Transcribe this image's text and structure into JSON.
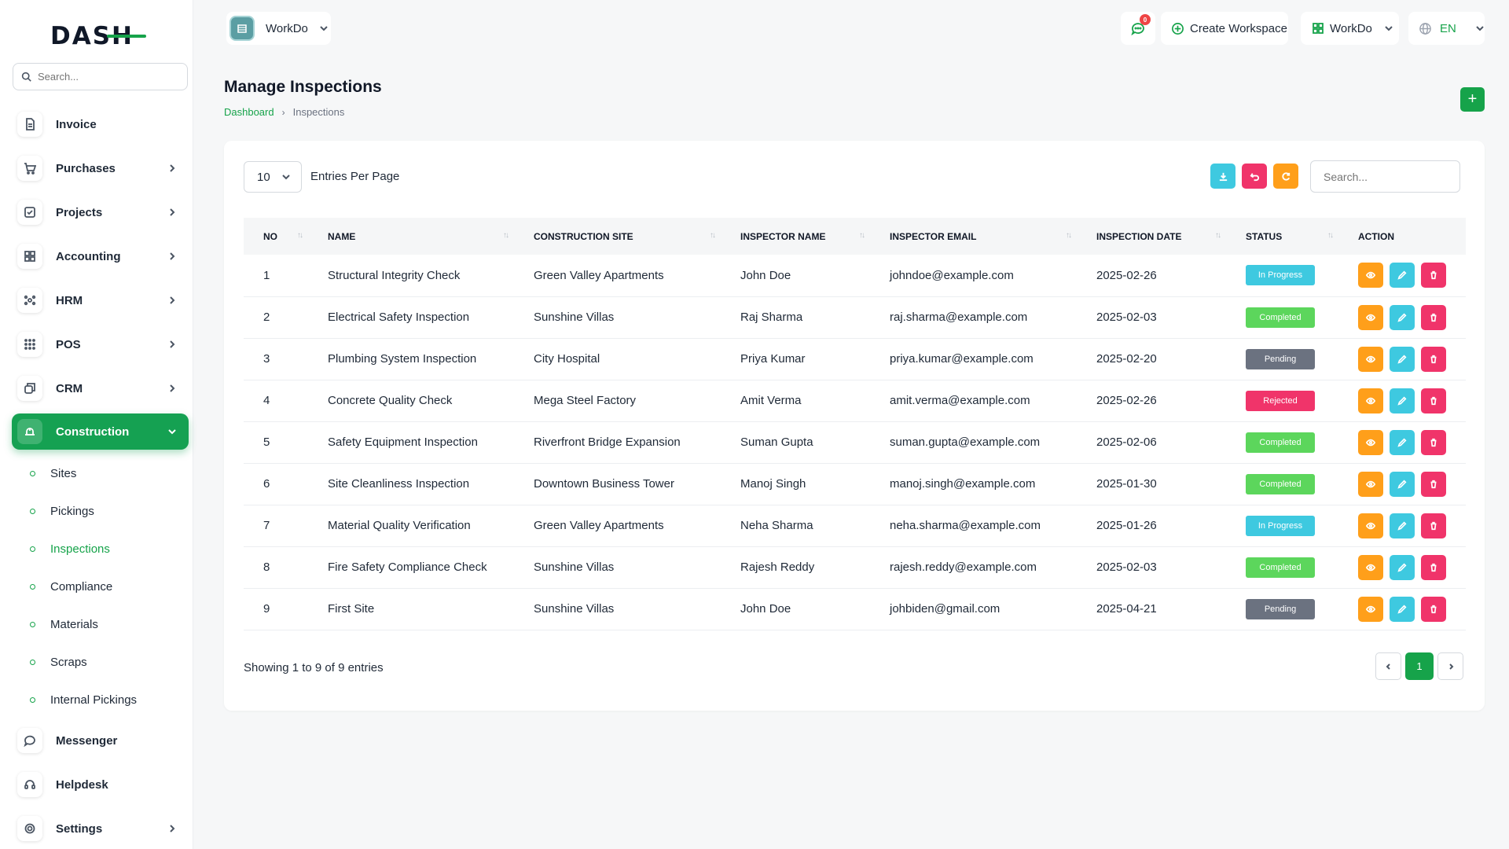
{
  "brand": {
    "logo_text": "DASH"
  },
  "sidebar": {
    "search_placeholder": "Search...",
    "items": [
      {
        "label": "Invoice",
        "icon": "file-icon",
        "has_children": false
      },
      {
        "label": "Purchases",
        "icon": "cart-icon",
        "has_children": true
      },
      {
        "label": "Projects",
        "icon": "checkbox-icon",
        "has_children": true
      },
      {
        "label": "Accounting",
        "icon": "grid-icon",
        "has_children": true
      },
      {
        "label": "HRM",
        "icon": "users-icon",
        "has_children": true
      },
      {
        "label": "POS",
        "icon": "dots-grid-icon",
        "has_children": true
      },
      {
        "label": "CRM",
        "icon": "layers-icon",
        "has_children": true
      },
      {
        "label": "Construction",
        "icon": "construction-icon",
        "has_children": true,
        "active": true
      },
      {
        "label": "Messenger",
        "icon": "chat-icon",
        "has_children": false
      },
      {
        "label": "Helpdesk",
        "icon": "headset-icon",
        "has_children": false
      },
      {
        "label": "Settings",
        "icon": "gear-icon",
        "has_children": true
      }
    ],
    "construction_sub": [
      "Sites",
      "Pickings",
      "Inspections",
      "Compliance",
      "Materials",
      "Scraps",
      "Internal Pickings"
    ],
    "active_sub": "Inspections"
  },
  "topbar": {
    "workspace_name": "WorkDo",
    "message_count": "0",
    "create_workspace": "Create Workspace",
    "workspace_switch": "WorkDo",
    "language": "EN"
  },
  "page": {
    "title": "Manage Inspections",
    "breadcrumb_home": "Dashboard",
    "breadcrumb_current": "Inspections",
    "add_label": "+"
  },
  "table_controls": {
    "per_page": "10",
    "per_page_label": "Entries Per Page",
    "search_placeholder": "Search..."
  },
  "table": {
    "columns": [
      "NO",
      "NAME",
      "CONSTRUCTION SITE",
      "INSPECTOR NAME",
      "INSPECTOR EMAIL",
      "INSPECTION DATE",
      "STATUS",
      "ACTION"
    ],
    "rows": [
      {
        "no": "1",
        "name": "Structural Integrity Check",
        "site": "Green Valley Apartments",
        "inspector": "John Doe",
        "email": "johndoe@example.com",
        "date": "2025-02-26",
        "status": "In Progress",
        "status_type": "progress"
      },
      {
        "no": "2",
        "name": "Electrical Safety Inspection",
        "site": "Sunshine Villas",
        "inspector": "Raj Sharma",
        "email": "raj.sharma@example.com",
        "date": "2025-02-03",
        "status": "Completed",
        "status_type": "completed"
      },
      {
        "no": "3",
        "name": "Plumbing System Inspection",
        "site": "City Hospital",
        "inspector": "Priya Kumar",
        "email": "priya.kumar@example.com",
        "date": "2025-02-20",
        "status": "Pending",
        "status_type": "pending"
      },
      {
        "no": "4",
        "name": "Concrete Quality Check",
        "site": "Mega Steel Factory",
        "inspector": "Amit Verma",
        "email": "amit.verma@example.com",
        "date": "2025-02-26",
        "status": "Rejected",
        "status_type": "rejected"
      },
      {
        "no": "5",
        "name": "Safety Equipment Inspection",
        "site": "Riverfront Bridge Expansion",
        "inspector": "Suman Gupta",
        "email": "suman.gupta@example.com",
        "date": "2025-02-06",
        "status": "Completed",
        "status_type": "completed"
      },
      {
        "no": "6",
        "name": "Site Cleanliness Inspection",
        "site": "Downtown Business Tower",
        "inspector": "Manoj Singh",
        "email": "manoj.singh@example.com",
        "date": "2025-01-30",
        "status": "Completed",
        "status_type": "completed"
      },
      {
        "no": "7",
        "name": "Material Quality Verification",
        "site": "Green Valley Apartments",
        "inspector": "Neha Sharma",
        "email": "neha.sharma@example.com",
        "date": "2025-01-26",
        "status": "In Progress",
        "status_type": "progress"
      },
      {
        "no": "8",
        "name": "Fire Safety Compliance Check",
        "site": "Sunshine Villas",
        "inspector": "Rajesh Reddy",
        "email": "rajesh.reddy@example.com",
        "date": "2025-02-03",
        "status": "Completed",
        "status_type": "completed"
      },
      {
        "no": "9",
        "name": "First Site",
        "site": "Sunshine Villas",
        "inspector": "John Doe",
        "email": "johbiden@gmail.com",
        "date": "2025-04-21",
        "status": "Pending",
        "status_type": "pending"
      }
    ]
  },
  "footer": {
    "showing": "Showing 1 to 9 of 9 entries",
    "current_page": "1"
  },
  "colors": {
    "primary": "#16a34a",
    "info": "#3ec9e0",
    "danger": "#f0346a",
    "warning": "#ff9f1a",
    "success_badge": "#5cd65c",
    "pending_badge": "#6b7280"
  }
}
